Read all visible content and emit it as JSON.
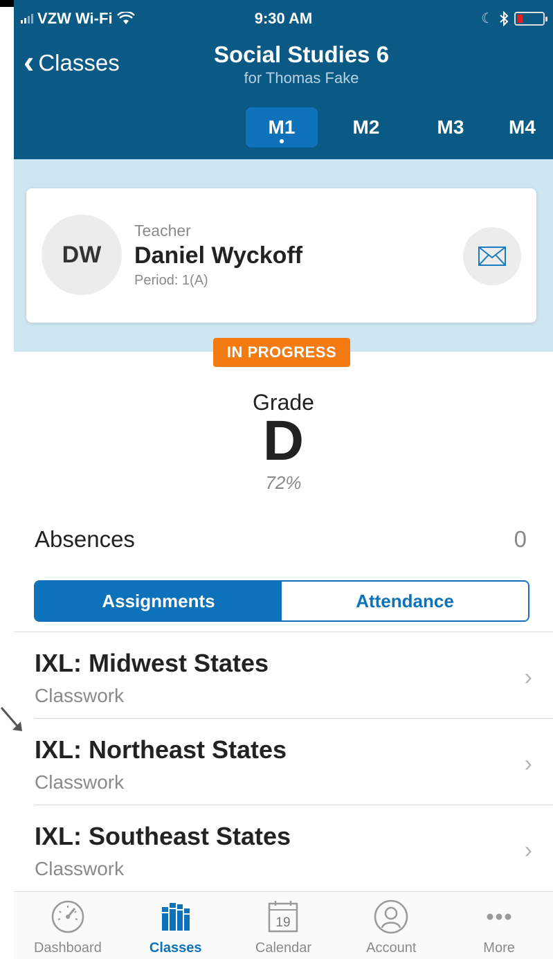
{
  "status_bar": {
    "carrier": "VZW Wi-Fi",
    "time": "9:30 AM"
  },
  "header": {
    "back_label": "Classes",
    "title": "Social Studies 6",
    "subtitle": "for Thomas Fake"
  },
  "marking_periods": [
    {
      "label": "M1",
      "active": true
    },
    {
      "label": "M2",
      "active": false
    },
    {
      "label": "M3",
      "active": false
    },
    {
      "label": "M4",
      "active": false
    }
  ],
  "teacher": {
    "initials": "DW",
    "role": "Teacher",
    "name": "Daniel Wyckoff",
    "period": "Period: 1(A)"
  },
  "status_badge": "IN PROGRESS",
  "grade": {
    "label": "Grade",
    "letter": "D",
    "percent": "72%"
  },
  "absences": {
    "label": "Absences",
    "value": "0"
  },
  "segment": {
    "assignments": "Assignments",
    "attendance": "Attendance",
    "selected": "Assignments"
  },
  "assignments": [
    {
      "title": "IXL: Midwest States",
      "category": "Classwork"
    },
    {
      "title": "IXL: Northeast States",
      "category": "Classwork"
    },
    {
      "title": "IXL: Southeast States",
      "category": "Classwork"
    }
  ],
  "tabbar": [
    {
      "label": "Dashboard",
      "icon": "speedometer-icon",
      "active": false
    },
    {
      "label": "Classes",
      "icon": "books-icon",
      "active": true
    },
    {
      "label": "Calendar",
      "icon": "calendar-icon",
      "active": false,
      "day": "19"
    },
    {
      "label": "Account",
      "icon": "person-icon",
      "active": false
    },
    {
      "label": "More",
      "icon": "ellipsis-icon",
      "active": false
    }
  ],
  "colors": {
    "header_bg": "#0a5a85",
    "accent": "#0d72b9",
    "card_area_bg": "#cde6f1",
    "badge": "#f47a12"
  }
}
